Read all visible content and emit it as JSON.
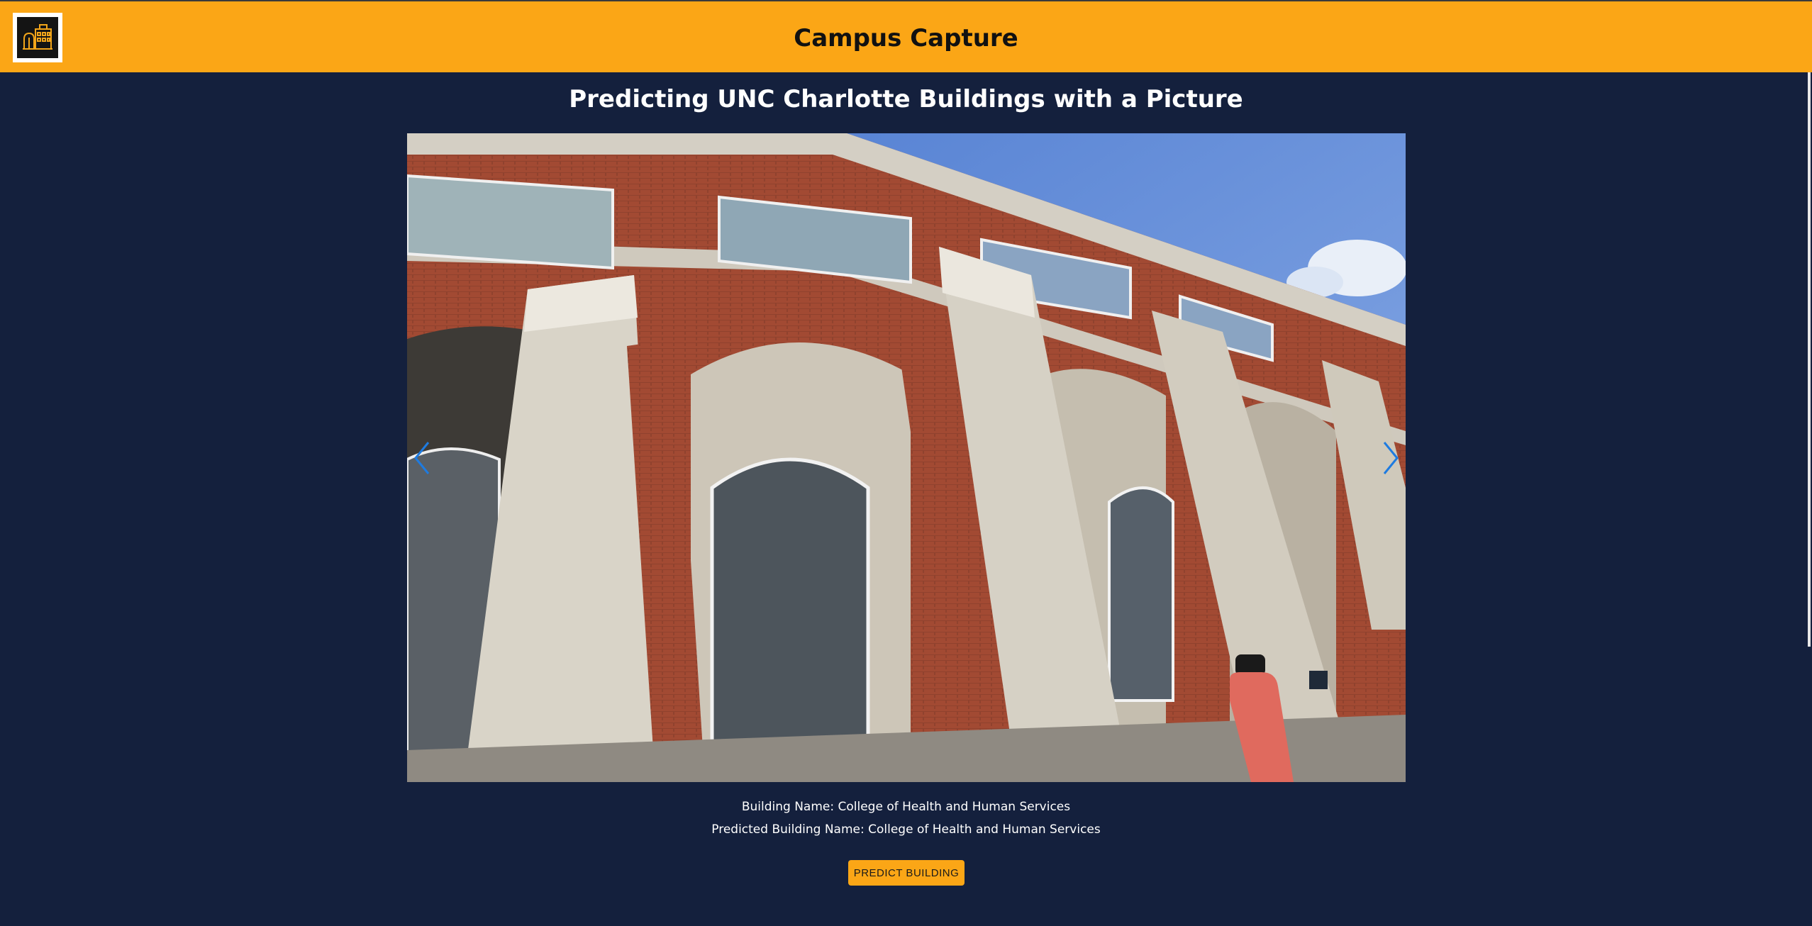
{
  "header": {
    "app_title": "Campus Capture",
    "logo_icon": "campus-building-logo",
    "background_color": "#fba616"
  },
  "main": {
    "page_title": "Predicting UNC Charlotte Buildings with a Picture",
    "background_color": "#14203d",
    "carousel": {
      "image_subject": "College of Health and Human Services building facade",
      "prev_icon": "chevron-left-icon",
      "next_icon": "chevron-right-icon",
      "arrow_color": "#1e7be0"
    },
    "building_name_text": "Building Name: College of Health and Human Services",
    "predicted_name_text": "Predicted Building Name: College of Health and Human Services",
    "predict_button_label": "PREDICT BUILDING"
  }
}
